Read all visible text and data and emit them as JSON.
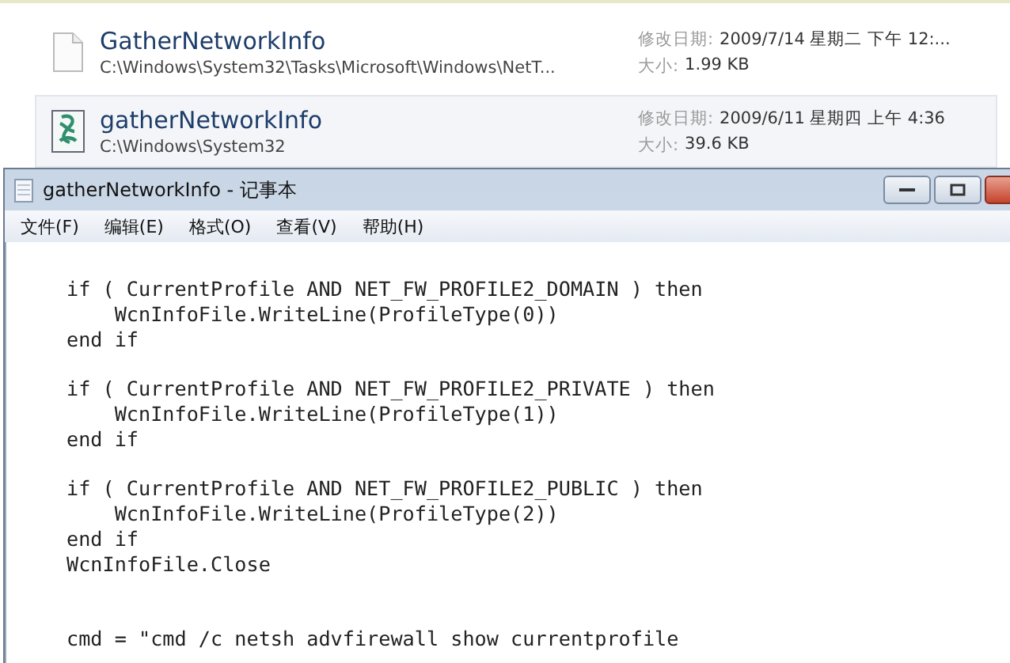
{
  "results": [
    {
      "kind": "blank-file",
      "name": "GatherNetworkInfo",
      "path": "C:\\Windows\\System32\\Tasks\\Microsoft\\Windows\\NetT...",
      "date_label": "修改日期:",
      "date": "2009/7/14 星期二 下午 12:...",
      "size_label": "大小:",
      "size": "1.99 KB",
      "selected": false
    },
    {
      "kind": "script-file",
      "name": "gatherNetworkInfo",
      "path": "C:\\Windows\\System32",
      "date_label": "修改日期:",
      "date": "2009/6/11 星期四 上午 4:36",
      "size_label": "大小:",
      "size": "39.6 KB",
      "selected": true
    }
  ],
  "window": {
    "title": "gatherNetworkInfo - 记事本"
  },
  "menu": [
    "文件(F)",
    "编辑(E)",
    "格式(O)",
    "查看(V)",
    "帮助(H)"
  ],
  "code": [
    {
      "kind": "text",
      "text": "if ( CurrentProfile AND NET_FW_PROFILE2_DOMAIN ) then"
    },
    {
      "kind": "text",
      "text": "    WcnInfoFile.WriteLine(ProfileType(0))"
    },
    {
      "kind": "text",
      "text": "end if"
    },
    {
      "kind": "blank"
    },
    {
      "kind": "text",
      "text": "if ( CurrentProfile AND NET_FW_PROFILE2_PRIVATE ) then"
    },
    {
      "kind": "text",
      "text": "    WcnInfoFile.WriteLine(ProfileType(1))"
    },
    {
      "kind": "text",
      "text": "end if"
    },
    {
      "kind": "blank"
    },
    {
      "kind": "text",
      "text": "if ( CurrentProfile AND NET_FW_PROFILE2_PUBLIC ) then"
    },
    {
      "kind": "text",
      "text": "    WcnInfoFile.WriteLine(ProfileType(2))"
    },
    {
      "kind": "text",
      "text": "end if"
    },
    {
      "kind": "text",
      "text": "WcnInfoFile.Close"
    },
    {
      "kind": "blank"
    },
    {
      "kind": "blank"
    },
    {
      "kind": "text",
      "text": "cmd = \"cmd /c netsh advfirewall show currentprofile"
    }
  ]
}
